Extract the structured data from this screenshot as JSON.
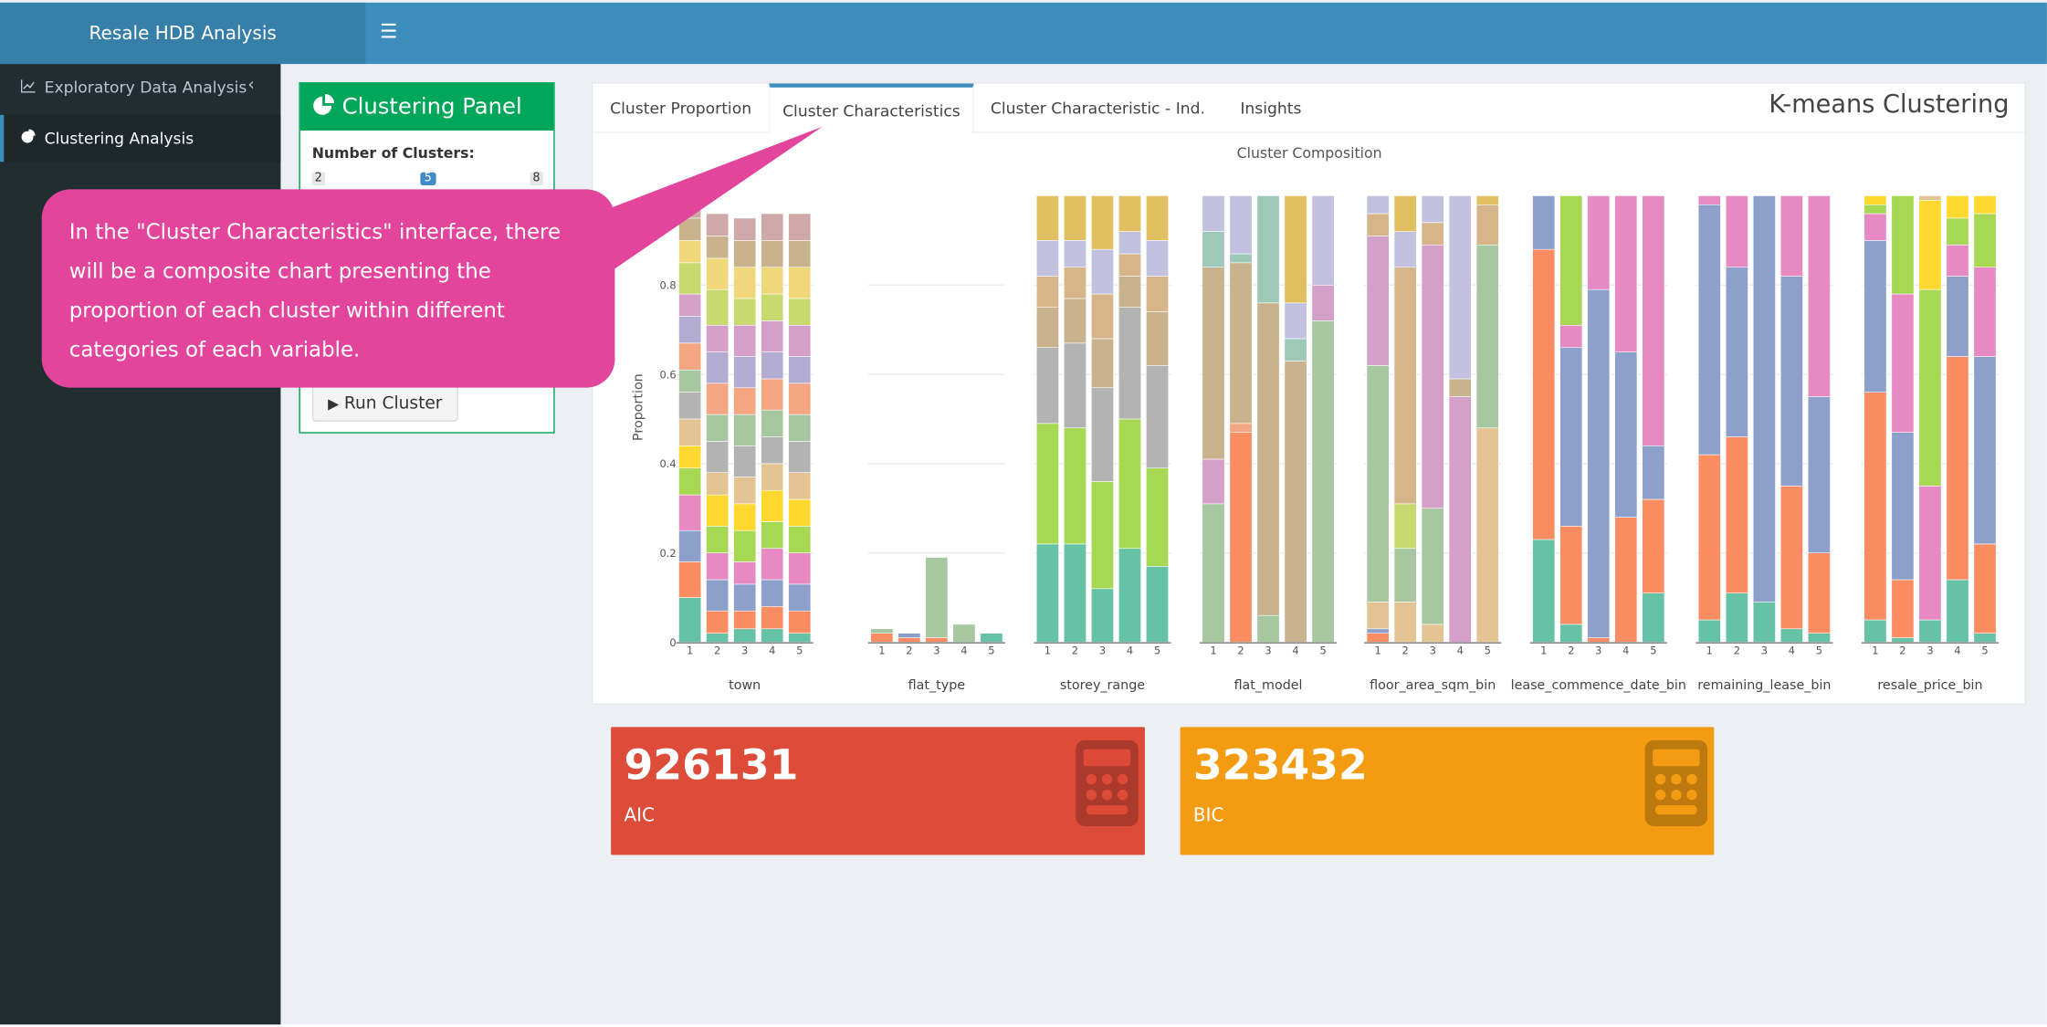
{
  "app": {
    "title": "Resale HDB Analysis",
    "menu_icon": "hamburger-icon"
  },
  "sidebar": {
    "items": [
      {
        "label": "Exploratory Data Analysis",
        "icon": "line-chart-icon"
      },
      {
        "label": "Clustering Analysis",
        "icon": "pie-chart-icon"
      }
    ]
  },
  "panel": {
    "title": "Clustering Panel",
    "icon": "pie-chart-icon",
    "clusters_label": "Number of Clusters:",
    "slider": {
      "min": "2",
      "value": "5",
      "max": "8"
    },
    "run_button": "Run Cluster"
  },
  "tabs": {
    "items": [
      "Cluster Proportion",
      "Cluster Characteristics",
      "Cluster Characteristic - Ind.",
      "Insights"
    ],
    "active": "Cluster Characteristics",
    "title": "K-means Clustering"
  },
  "annotation": {
    "text": "In the \"Cluster Characteristics\" interface, there will be a composite chart presenting the proportion of each cluster within different categories of each variable."
  },
  "valueboxes": [
    {
      "value": "926131",
      "label": "AIC",
      "color": "#dd4b39",
      "icon": "calculator-icon"
    },
    {
      "value": "323432",
      "label": "BIC",
      "color": "#f39c12",
      "icon": "calculator-icon"
    }
  ],
  "colors": {
    "header": "#3c8dbc",
    "sidebar": "#222d32",
    "panel_accent": "#00a65a",
    "callout": "#e2459b"
  },
  "chart_data": {
    "type": "bar",
    "title": "Cluster Composition",
    "ylabel": "Proportion",
    "ylim": [
      0,
      1
    ],
    "yticks": [
      "0",
      "0.2",
      "0.4",
      "0.6",
      "0.8"
    ],
    "x": [
      "1",
      "2",
      "3",
      "4",
      "5"
    ],
    "variables": [
      {
        "name": "town",
        "stacks": [
          [
            0.1,
            0.08,
            0.07,
            0.08,
            0.06,
            0.05,
            0.06,
            0.06,
            0.05,
            0.06,
            0.06,
            0.05,
            0.07,
            0.05,
            0.05,
            0.05
          ],
          [
            0.02,
            0.05,
            0.07,
            0.06,
            0.06,
            0.07,
            0.05,
            0.07,
            0.06,
            0.07,
            0.07,
            0.06,
            0.08,
            0.07,
            0.05,
            0.05
          ],
          [
            0.03,
            0.04,
            0.06,
            0.05,
            0.07,
            0.06,
            0.06,
            0.07,
            0.07,
            0.06,
            0.07,
            0.07,
            0.06,
            0.07,
            0.06,
            0.05
          ],
          [
            0.03,
            0.05,
            0.06,
            0.07,
            0.06,
            0.07,
            0.06,
            0.06,
            0.06,
            0.07,
            0.06,
            0.07,
            0.06,
            0.06,
            0.06,
            0.06
          ],
          [
            0.02,
            0.05,
            0.06,
            0.07,
            0.06,
            0.06,
            0.06,
            0.07,
            0.06,
            0.07,
            0.06,
            0.07,
            0.06,
            0.07,
            0.06,
            0.06
          ]
        ]
      },
      {
        "name": "flat_type",
        "stacks": [
          [
            0.0,
            0.02,
            0.0,
            0.0,
            0.0,
            0.0,
            0.0,
            0.0,
            0.01,
            0.0,
            0.0,
            0.0,
            0.0,
            0.0,
            0.0,
            0.0,
            0.0,
            0.0,
            0.0
          ],
          [
            0.0,
            0.01,
            0.01,
            0.0,
            0.0,
            0.0,
            0.0,
            0.0,
            0.0,
            0.0,
            0.0,
            0.0,
            0.0,
            0.0,
            0.0,
            0.0,
            0.0,
            0.0,
            0.0
          ],
          [
            0.0,
            0.01,
            0.0,
            0.0,
            0.0,
            0.0,
            0.0,
            0.0,
            0.18,
            0.0,
            0.0,
            0.0,
            0.0,
            0.0,
            0.0,
            0.0,
            0.0,
            0.0,
            0.0
          ],
          [
            0.0,
            0.0,
            0.0,
            0.0,
            0.0,
            0.0,
            0.0,
            0.0,
            0.04,
            0.0,
            0.0,
            0.0,
            0.0,
            0.0,
            0.0,
            0.0,
            0.0,
            0.0,
            0.0
          ],
          [
            0.02,
            0.0,
            0.0,
            0.0,
            0.0,
            0.0,
            0.0,
            0.0,
            0.0,
            0.0,
            0.0,
            0.0,
            0.0,
            0.0,
            0.0,
            0.0,
            0.0,
            0.0,
            0.0
          ]
        ]
      },
      {
        "name": "storey_range",
        "stacks": [
          [
            0.22,
            0.0,
            0.0,
            0.0,
            0.27,
            0.0,
            0.0,
            0.17,
            0.0,
            0.0,
            0.0,
            0.0,
            0.0,
            0.0,
            0.09,
            0.0,
            0.0,
            0.07,
            0.08,
            0.1
          ],
          [
            0.22,
            0.0,
            0.0,
            0.0,
            0.26,
            0.0,
            0.0,
            0.19,
            0.0,
            0.0,
            0.0,
            0.0,
            0.0,
            0.0,
            0.1,
            0.0,
            0.0,
            0.07,
            0.06,
            0.1
          ],
          [
            0.12,
            0.0,
            0.0,
            0.0,
            0.24,
            0.0,
            0.0,
            0.21,
            0.0,
            0.0,
            0.0,
            0.0,
            0.0,
            0.0,
            0.11,
            0.0,
            0.0,
            0.1,
            0.1,
            0.12
          ],
          [
            0.21,
            0.0,
            0.0,
            0.0,
            0.29,
            0.0,
            0.0,
            0.25,
            0.0,
            0.0,
            0.0,
            0.0,
            0.0,
            0.0,
            0.07,
            0.0,
            0.0,
            0.05,
            0.05,
            0.08
          ],
          [
            0.17,
            0.0,
            0.0,
            0.0,
            0.22,
            0.0,
            0.0,
            0.23,
            0.0,
            0.0,
            0.0,
            0.0,
            0.0,
            0.0,
            0.12,
            0.0,
            0.0,
            0.08,
            0.08,
            0.1
          ]
        ]
      },
      {
        "name": "flat_model",
        "stacks": [
          [
            0.0,
            0.0,
            0.0,
            0.0,
            0.0,
            0.0,
            0.0,
            0.0,
            0.31,
            0.0,
            0.0,
            0.1,
            0.0,
            0.0,
            0.43,
            0.0,
            0.08,
            0.0,
            0.08,
            0.0
          ],
          [
            0.0,
            0.47,
            0.0,
            0.0,
            0.0,
            0.0,
            0.0,
            0.0,
            0.0,
            0.02,
            0.0,
            0.0,
            0.0,
            0.0,
            0.36,
            0.0,
            0.02,
            0.0,
            0.13,
            0.0
          ],
          [
            0.0,
            0.0,
            0.0,
            0.0,
            0.0,
            0.0,
            0.0,
            0.0,
            0.06,
            0.0,
            0.0,
            0.0,
            0.0,
            0.0,
            0.7,
            0.0,
            0.24,
            0.0,
            0.0,
            0.0
          ],
          [
            0.0,
            0.0,
            0.0,
            0.0,
            0.0,
            0.0,
            0.0,
            0.0,
            0.0,
            0.0,
            0.0,
            0.0,
            0.0,
            0.0,
            0.63,
            0.0,
            0.05,
            0.0,
            0.08,
            0.24
          ],
          [
            0.0,
            0.0,
            0.0,
            0.0,
            0.0,
            0.0,
            0.0,
            0.0,
            0.72,
            0.0,
            0.0,
            0.08,
            0.0,
            0.0,
            0.0,
            0.0,
            0.0,
            0.0,
            0.2,
            0.0
          ]
        ]
      },
      {
        "name": "floor_area_sqm_bin",
        "stacks": [
          [
            0.0,
            0.02,
            0.01,
            0.0,
            0.0,
            0.0,
            0.06,
            0.0,
            0.53,
            0.0,
            0.0,
            0.29,
            0.0,
            0.0,
            0.0,
            0.0,
            0.0,
            0.05,
            0.04,
            0.0
          ],
          [
            0.0,
            0.0,
            0.0,
            0.0,
            0.0,
            0.0,
            0.09,
            0.0,
            0.12,
            0.0,
            0.0,
            0.0,
            0.1,
            0.0,
            0.0,
            0.0,
            0.0,
            0.53,
            0.08,
            0.08
          ],
          [
            0.0,
            0.0,
            0.0,
            0.0,
            0.0,
            0.0,
            0.04,
            0.0,
            0.26,
            0.0,
            0.0,
            0.59,
            0.0,
            0.0,
            0.0,
            0.0,
            0.0,
            0.05,
            0.06,
            0.0
          ],
          [
            0.0,
            0.0,
            0.0,
            0.0,
            0.0,
            0.0,
            0.0,
            0.0,
            0.0,
            0.0,
            0.0,
            0.55,
            0.0,
            0.0,
            0.04,
            0.0,
            0.0,
            0.0,
            0.41,
            0.0
          ],
          [
            0.0,
            0.0,
            0.0,
            0.0,
            0.0,
            0.0,
            0.48,
            0.0,
            0.41,
            0.0,
            0.0,
            0.0,
            0.0,
            0.0,
            0.0,
            0.0,
            0.0,
            0.09,
            0.0,
            0.02
          ]
        ]
      },
      {
        "name": "lease_commence_date_bin",
        "stacks": [
          [
            0.23,
            0.65,
            0.12,
            0.0
          ],
          [
            0.04,
            0.22,
            0.4,
            0.05,
            0.29
          ],
          [
            0.0,
            0.01,
            0.78,
            0.21
          ],
          [
            0.0,
            0.28,
            0.37,
            0.35
          ],
          [
            0.11,
            0.21,
            0.12,
            0.56
          ]
        ]
      },
      {
        "name": "remaining_lease_bin",
        "stacks": [
          [
            0.05,
            0.37,
            0.56,
            0.02
          ],
          [
            0.11,
            0.35,
            0.38,
            0.16
          ],
          [
            0.09,
            0.0,
            0.91
          ],
          [
            0.03,
            0.32,
            0.47,
            0.18
          ],
          [
            0.02,
            0.18,
            0.35,
            0.45
          ]
        ]
      },
      {
        "name": "resale_price_bin",
        "stacks": [
          [
            0.05,
            0.51,
            0.34,
            0.06,
            0.02,
            0.02
          ],
          [
            0.01,
            0.13,
            0.33,
            0.31,
            0.22
          ],
          [
            0.05,
            0.0,
            0.0,
            0.3,
            0.44,
            0.2,
            0.01
          ],
          [
            0.14,
            0.5,
            0.18,
            0.07,
            0.06,
            0.05
          ],
          [
            0.02,
            0.2,
            0.42,
            0.2,
            0.12,
            0.04
          ]
        ]
      }
    ]
  }
}
